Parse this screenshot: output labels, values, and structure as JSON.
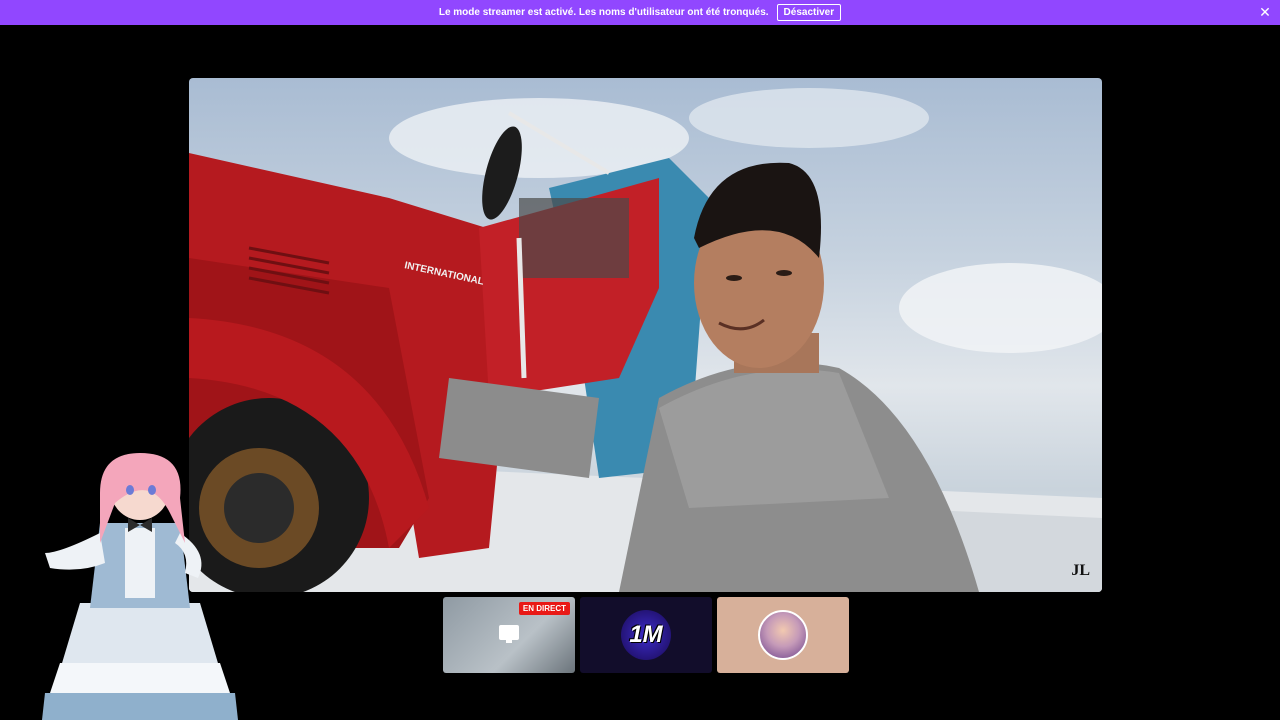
{
  "banner": {
    "message": "Le mode streamer est activé. Les noms d'utilisateur ont été tronqués.",
    "button_label": "Désactiver",
    "close_icon": "close-icon",
    "color": "#9147ff"
  },
  "video": {
    "watermark": "JL",
    "truck_label": "INTERNATIONAL"
  },
  "thumbnails": [
    {
      "badge": "EN DIRECT",
      "icon": "screen-share-icon"
    },
    {
      "logo_text": "1M"
    },
    {
      "icon": "avatar"
    }
  ]
}
